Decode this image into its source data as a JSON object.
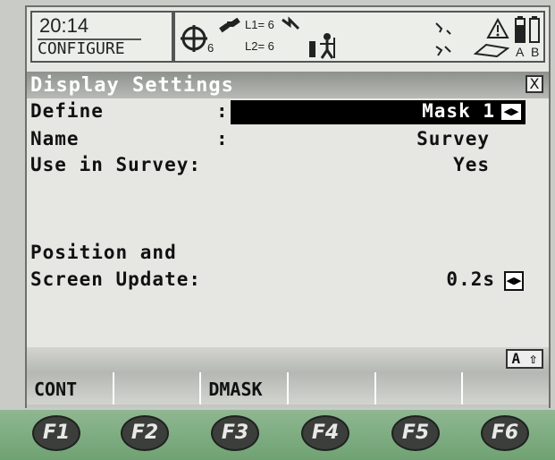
{
  "status": {
    "time": "20:14",
    "mode": "CONFIGURE",
    "l1": "L1= 6",
    "l2": "L2= 6",
    "sat": "6",
    "battery_a": "A",
    "battery_b": "B"
  },
  "dialog": {
    "title": "Display Settings",
    "close": "X"
  },
  "fields": {
    "define_label": "Define",
    "define_sep": ":",
    "define_value": "Mask 1",
    "name_label": "Name",
    "name_sep": ":",
    "name_value": "Survey",
    "use_label": "Use in Survey:",
    "use_value": "Yes",
    "pos_label_1": "Position and",
    "pos_label_2": "Screen Update:",
    "pos_value": "0.2s"
  },
  "input_mode": "A ⇧",
  "softkeys": [
    "CONT",
    "",
    "DMASK",
    "",
    "",
    ""
  ],
  "fkeys": [
    "F1",
    "F2",
    "F3",
    "F4",
    "F5",
    "F6"
  ]
}
